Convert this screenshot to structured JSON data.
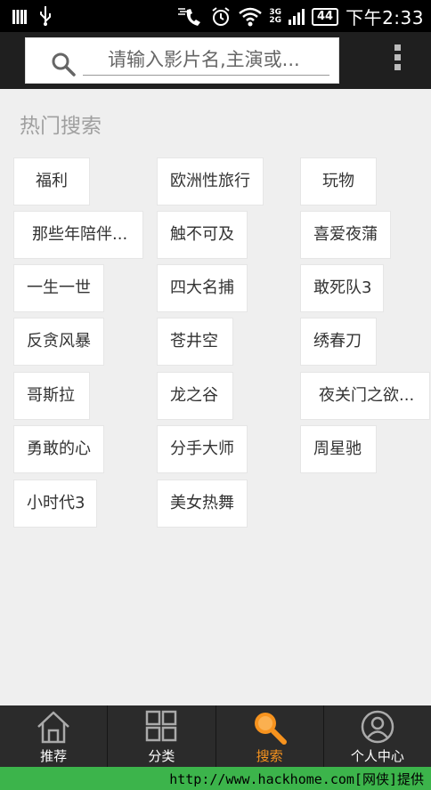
{
  "status_bar": {
    "time": "下午2:33",
    "battery": "44",
    "network_top": "3G",
    "network_bottom": "2G"
  },
  "search": {
    "placeholder": "请输入影片名,主演或..."
  },
  "hot_search": {
    "title": "热门搜索",
    "tags": [
      "福利",
      "欧洲性旅行",
      "玩物",
      "那些年陪伴...",
      "触不可及",
      "喜爱夜蒲",
      "一生一世",
      "四大名捕",
      "敢死队3",
      "反贪风暴",
      "苍井空",
      "绣春刀",
      "哥斯拉",
      "龙之谷",
      "夜关门之欲...",
      "勇敢的心",
      "分手大师",
      "周星驰",
      "小时代3",
      "美女热舞"
    ]
  },
  "bottom_nav": {
    "items": [
      {
        "label": "推荐",
        "icon": "home-icon"
      },
      {
        "label": "分类",
        "icon": "grid-icon"
      },
      {
        "label": "搜索",
        "icon": "search-icon",
        "active": true
      },
      {
        "label": "个人中心",
        "icon": "user-icon"
      }
    ]
  },
  "footer": {
    "text": "http://www.hackhome.com[网侠]提供"
  },
  "colors": {
    "accent": "#f7931e",
    "header_bg": "#1f1f1f",
    "nav_bg": "#2b2b2b",
    "page_bg": "#efefef"
  }
}
